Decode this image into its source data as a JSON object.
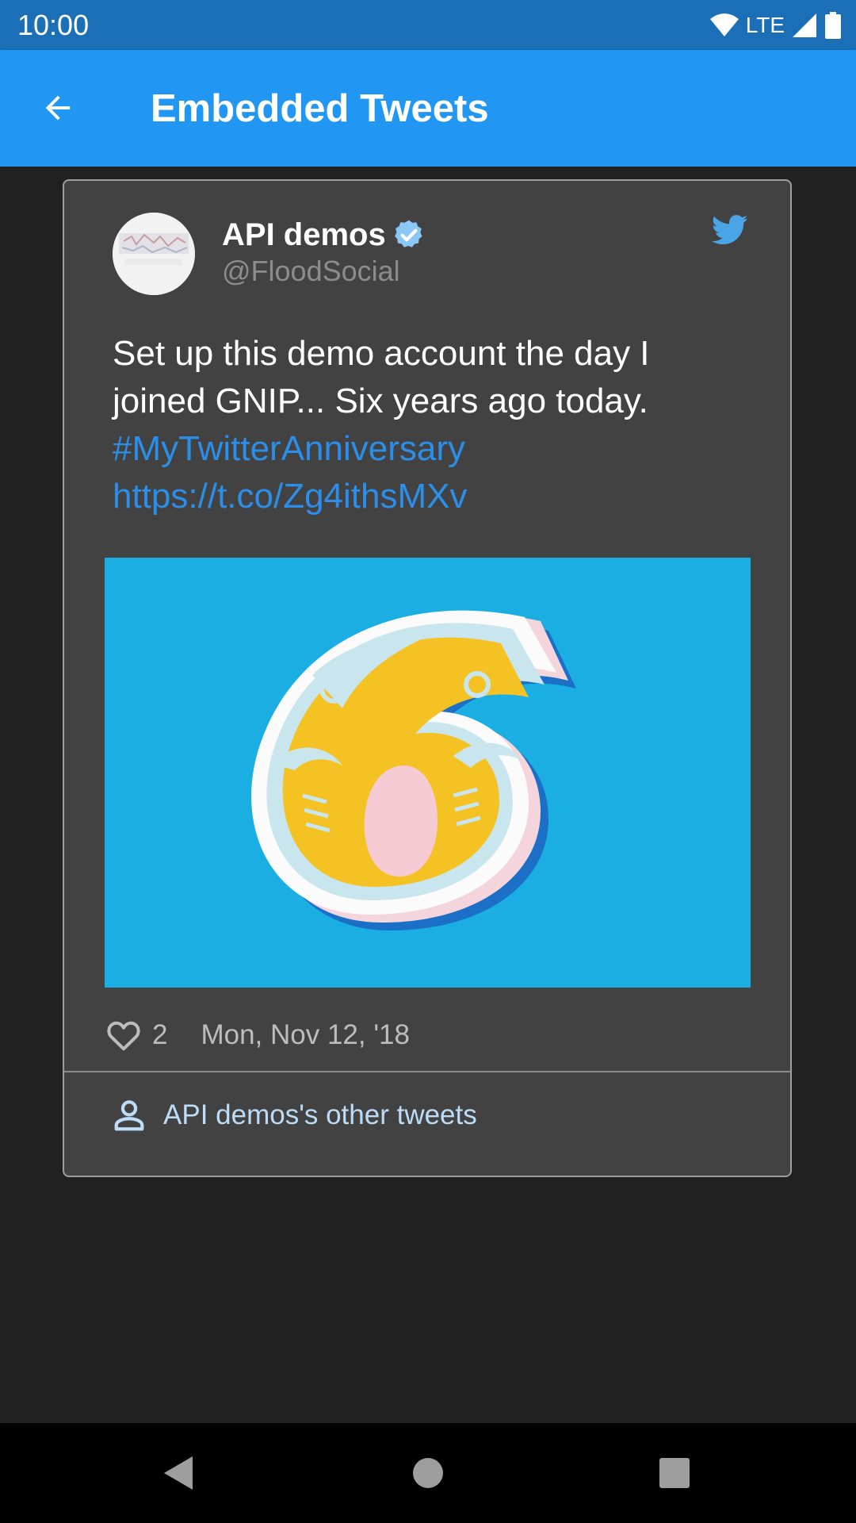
{
  "status_bar": {
    "time": "10:00",
    "network": "LTE",
    "icons": [
      "wifi-icon",
      "cell-signal-icon",
      "battery-icon"
    ]
  },
  "app_bar": {
    "title": "Embedded Tweets",
    "back_icon": "arrow-back-icon",
    "color": "#2296f3"
  },
  "tweet": {
    "author_name": "API demos",
    "author_handle": "@FloodSocial",
    "verified": true,
    "text": "Set up this demo account the day I joined GNIP... Six years ago today.",
    "hashtag": "#MyTwitterAnniversary",
    "link": "https://t.co/Zg4ithsMXv",
    "like_count": "2",
    "date": "Mon, Nov 12, '18",
    "other_tweets_label": "API demos's other tweets",
    "link_color": "#2b8ee9",
    "card_color": "#424242"
  },
  "nav_bar": {
    "buttons": [
      "back-triangle-icon",
      "home-circle-icon",
      "recents-square-icon"
    ]
  }
}
